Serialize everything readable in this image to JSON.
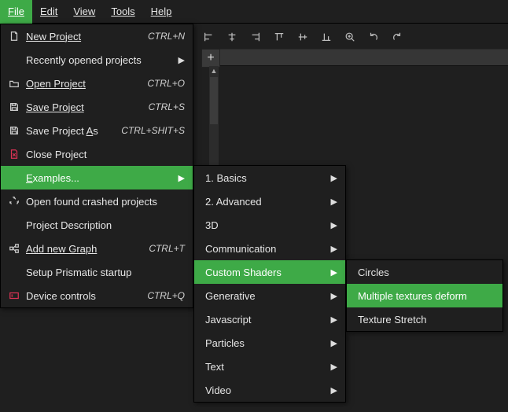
{
  "menubar": {
    "file": "File",
    "edit": "Edit",
    "view": "View",
    "tools": "Tools",
    "help": "Help"
  },
  "file_menu": {
    "new_project": {
      "label": "New Project",
      "shortcut": "CTRL+N"
    },
    "recent": {
      "label": "Recently opened projects"
    },
    "open_project": {
      "label": "Open Project",
      "shortcut": "CTRL+O"
    },
    "save_project": {
      "label": "Save Project",
      "shortcut": "CTRL+S"
    },
    "save_project_as": {
      "label": "Save Project As",
      "shortcut": "CTRL+SHIT+S"
    },
    "close_project": {
      "label": "Close Project"
    },
    "examples": {
      "label": "Examples..."
    },
    "open_crashed": {
      "label": "Open found crashed projects"
    },
    "project_desc": {
      "label": "Project Description"
    },
    "add_graph": {
      "label": "Add new Graph",
      "shortcut": "CTRL+T"
    },
    "setup_startup": {
      "label": "Setup Prismatic startup"
    },
    "device_controls": {
      "label": "Device controls",
      "shortcut": "CTRL+Q"
    }
  },
  "examples_menu": {
    "basics": "1. Basics",
    "advanced": "2. Advanced",
    "three_d": "3D",
    "communication": "Communication",
    "custom_shaders": "Custom Shaders",
    "generative": "Generative",
    "javascript": "Javascript",
    "particles": "Particles",
    "text": "Text",
    "video": "Video"
  },
  "shaders_menu": {
    "circles": "Circles",
    "multi_tex_deform": "Multiple textures deform",
    "texture_stretch": "Texture Stretch"
  },
  "glyphs": {
    "arrow_right": "▶",
    "arrow_up": "▲"
  }
}
